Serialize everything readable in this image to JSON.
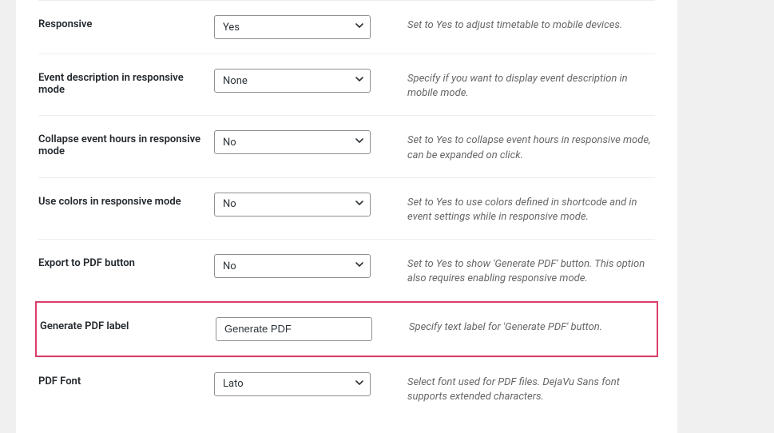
{
  "rows": {
    "responsive": {
      "label": "Responsive",
      "value": "Yes",
      "desc": "Set to Yes to adjust timetable to mobile devices."
    },
    "event_desc": {
      "label": "Event description in responsive mode",
      "value": "None",
      "desc": "Specify if you want to display event description in mobile mode."
    },
    "collapse_hours": {
      "label": "Collapse event hours in responsive mode",
      "value": "No",
      "desc": "Set to Yes to collapse event hours in responsive mode, can be expanded on click."
    },
    "use_colors": {
      "label": "Use colors in responsive mode",
      "value": "No",
      "desc": "Set to Yes to use colors defined in shortcode and in event settings while in responsive mode."
    },
    "export_pdf": {
      "label": "Export to PDF button",
      "value": "No",
      "desc": "Set to Yes to show 'Generate PDF' button. This option also requires enabling responsive mode."
    },
    "generate_label": {
      "label": "Generate PDF label",
      "value": "Generate PDF",
      "desc": "Specify text label for 'Generate PDF' button."
    },
    "pdf_font": {
      "label": "PDF Font",
      "value": "Lato",
      "desc": "Select font used for PDF files. DejaVu Sans font supports extended characters."
    }
  }
}
